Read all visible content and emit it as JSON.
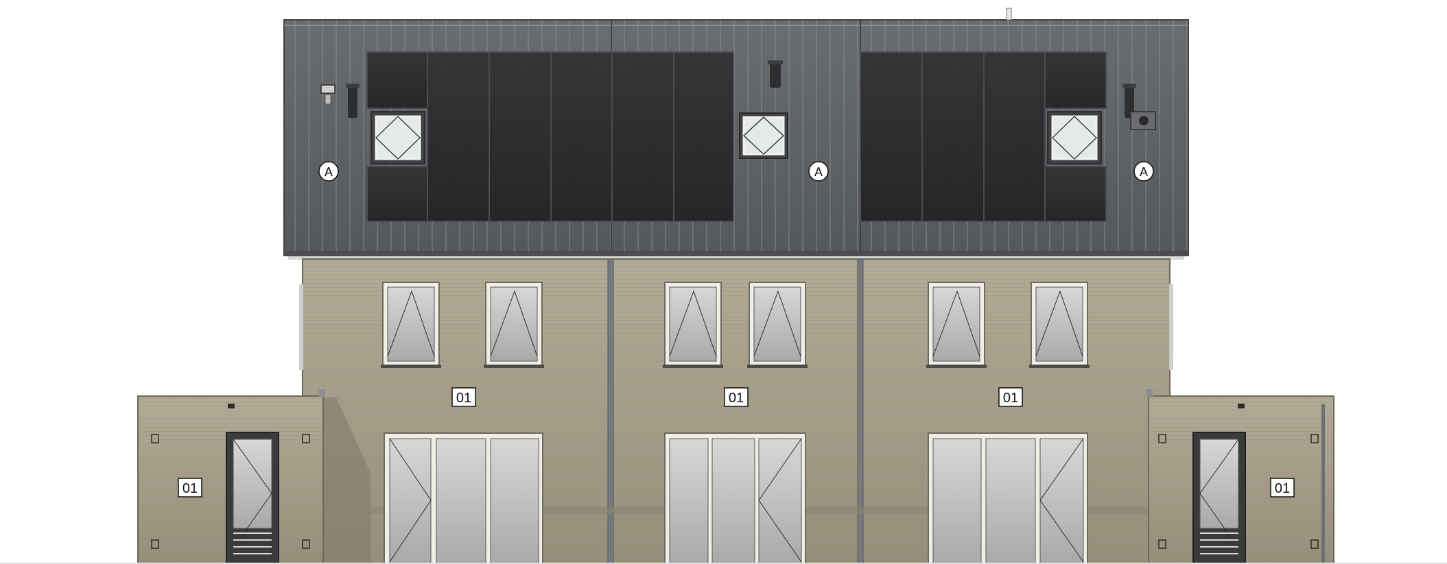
{
  "drawing": {
    "type": "facade elevation",
    "units": 3,
    "roof_material_tag": "A",
    "facade_material_tag": "01",
    "colors": {
      "roof": "#5d6063",
      "solar_panel": "#2c2d2f",
      "facade": "#a59e89",
      "frame": "#f1eee6",
      "glass": "#c9c9c9",
      "roof_window_glass": "#e4ebe7",
      "divider": "#77797c"
    }
  },
  "roof_tags": [
    "A",
    "A",
    "A"
  ],
  "facade_tags": [
    "01",
    "01",
    "01"
  ],
  "storage_tags": [
    "01",
    "01"
  ]
}
